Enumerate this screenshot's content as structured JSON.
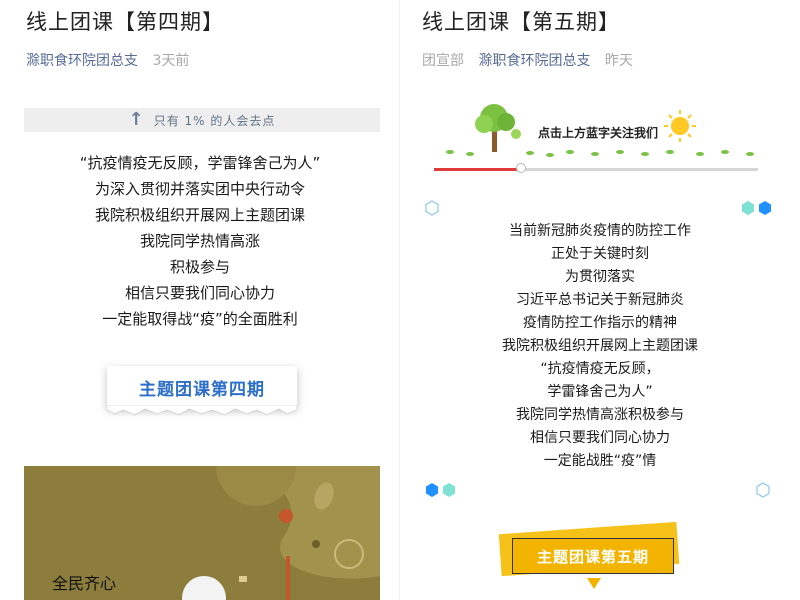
{
  "left": {
    "title": "线上团课【第四期】",
    "account": "滁职食环院团总支",
    "time": "3天前",
    "banner_text": "只有 1% 的人会去点",
    "poem": [
      "“抗疫情疫无反顾，学雷锋舍己为人”",
      "为深入贯彻并落实团中央行动令",
      "我院积极组织开展网上主题团课",
      "我院同学热情高涨",
      "积极参与",
      "相信只要我们同心协力",
      "一定能取得战“疫”的全面胜利"
    ],
    "button_label": "主题团课第四期",
    "poster_text": "全民齐心"
  },
  "right": {
    "title": "线上团课【第五期】",
    "dept": "团宣部",
    "account": "滁职食环院团总支",
    "time": "昨天",
    "follow_text": "点击上方蓝字关注我们",
    "progress": 0.27,
    "poem": [
      "当前新冠肺炎疫情的防控工作",
      "正处于关键时刻",
      "为贯彻落实",
      "习近平总书记关于新冠肺炎",
      "疫情防控工作指示的精神",
      "我院积极组织开展网上主题团课",
      "“抗疫情疫无反顾，",
      "学雷锋舍己为人”",
      "我院同学热情高涨积极参与",
      "相信只要我们同心协力",
      "一定能战胜“疫”情"
    ],
    "button_label": "主题团课第五期"
  },
  "colors": {
    "account": "#576b95",
    "blue_button_text": "#2e6fc9",
    "yellow_button": "#f3b400",
    "poster_bg": "#8c7d3c"
  }
}
